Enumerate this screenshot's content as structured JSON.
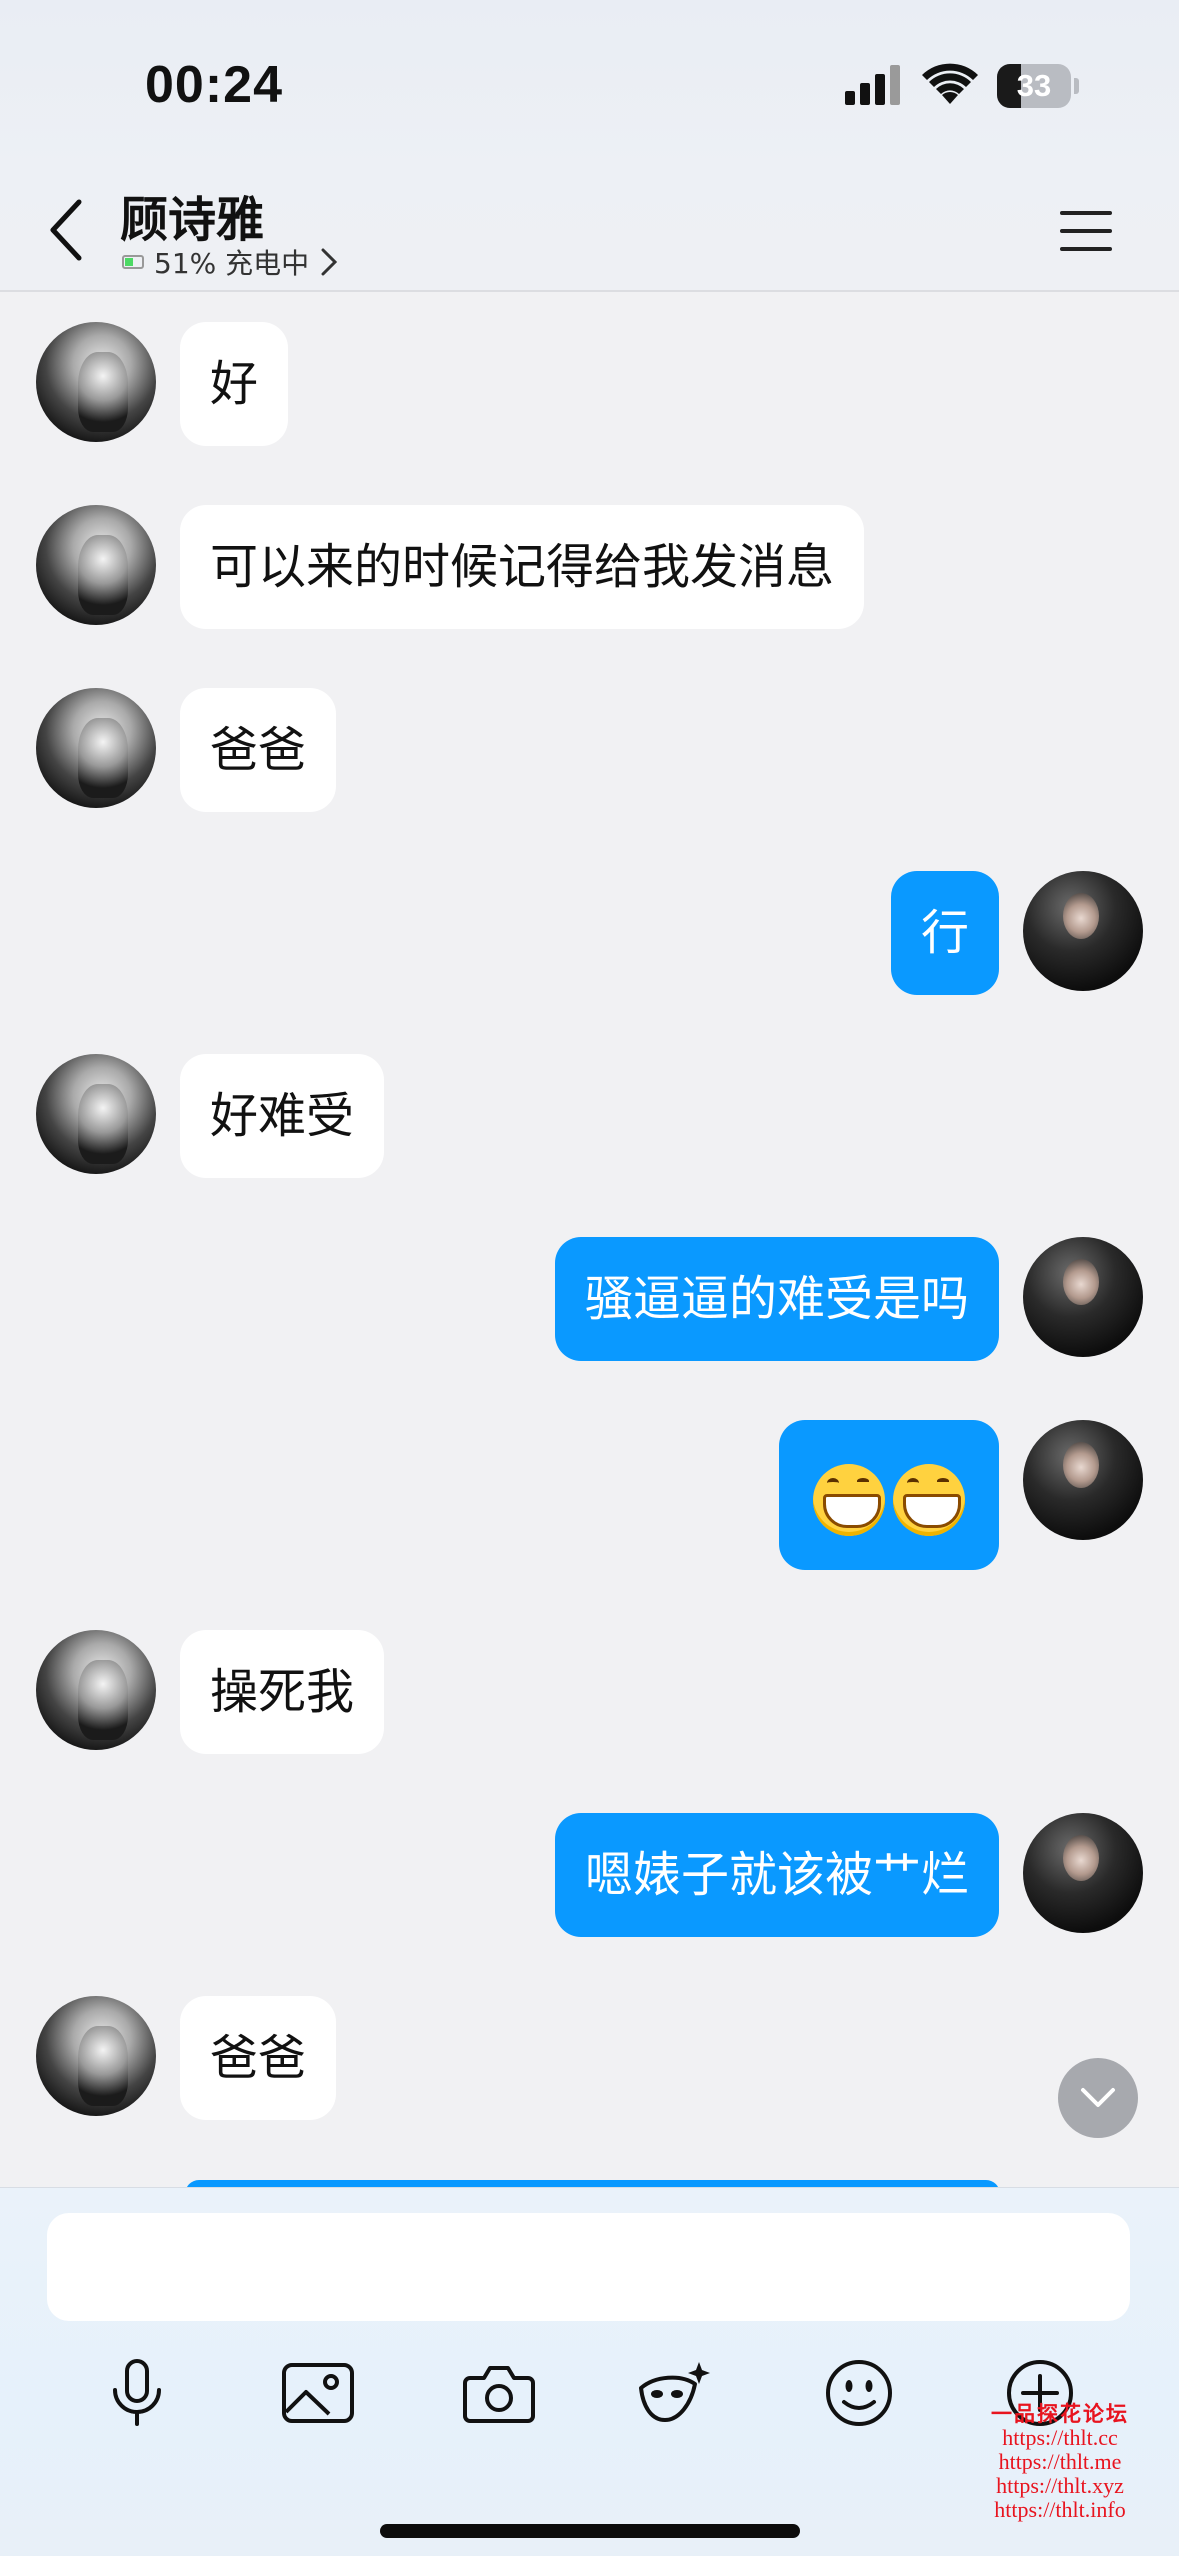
{
  "status_bar": {
    "time": "00:24",
    "battery_level": "33"
  },
  "header": {
    "contact_name": "顾诗雅",
    "contact_status": "51% 充电中",
    "icons": [
      "back-chevron-icon",
      "battery-icon",
      "chevron-right-icon",
      "hamburger-menu-icon"
    ]
  },
  "messages": [
    {
      "sender": "her",
      "text": "好"
    },
    {
      "sender": "her",
      "text": "可以来的时候记得给我发消息"
    },
    {
      "sender": "her",
      "text": "爸爸"
    },
    {
      "sender": "me",
      "text": "行"
    },
    {
      "sender": "her",
      "text": "好难受"
    },
    {
      "sender": "me",
      "text": "骚逼逼的难受是吗"
    },
    {
      "sender": "me",
      "emoji": "grinning-face-emoji ×2"
    },
    {
      "sender": "her",
      "text": "操死我"
    },
    {
      "sender": "me",
      "text": "嗯婊子就该被艹烂"
    },
    {
      "sender": "her",
      "text": "爸爸"
    }
  ],
  "composer": {
    "input_value": "",
    "tools": [
      "microphone-icon",
      "image-icon",
      "camera-icon",
      "magic-effect-icon",
      "emoji-icon",
      "plus-icon"
    ]
  },
  "watermark": {
    "title": "一品探花论坛",
    "lines": [
      "https://thlt.cc",
      "https://thlt.me",
      "https://thlt.xyz",
      "https://thlt.info"
    ]
  },
  "colors": {
    "my_bubble": "#0a99ff",
    "her_bubble": "#ffffff",
    "background": "#f1f1f3"
  }
}
